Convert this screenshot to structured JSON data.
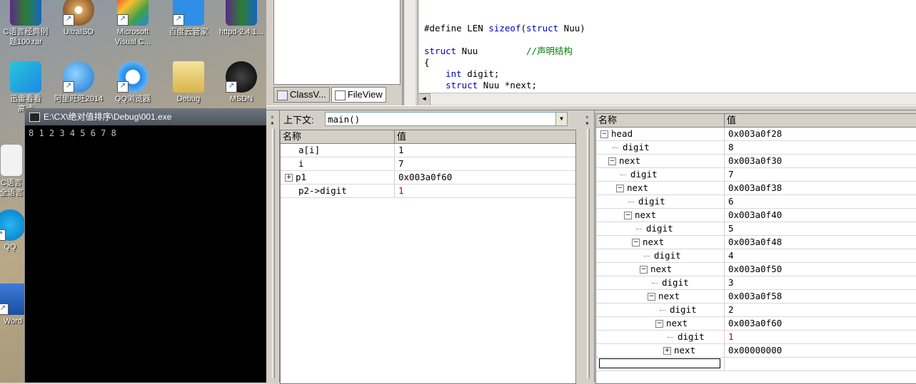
{
  "desktop": {
    "icons": [
      {
        "id": "c100",
        "label": "C语言经典例\n题100.rar"
      },
      {
        "id": "ultraiso",
        "label": "UltraISO"
      },
      {
        "id": "msvc",
        "label": "Microsoft\nVisual C..."
      },
      {
        "id": "baidu",
        "label": "百度云管家"
      },
      {
        "id": "httpd",
        "label": "httpd-2.4.1..."
      },
      {
        "id": "xunlei",
        "label": "迅雷看看\n高清"
      },
      {
        "id": "aliww",
        "label": "阿里旺旺2014"
      },
      {
        "id": "qqbrowser",
        "label": "QQ浏览器"
      },
      {
        "id": "debug",
        "label": "Debug"
      },
      {
        "id": "msdn",
        "label": "MSDN"
      },
      {
        "id": "cside",
        "label": "C语言\n全语言"
      },
      {
        "id": "qq",
        "label": "QQ"
      },
      {
        "id": "word",
        "label": "Word"
      }
    ]
  },
  "console": {
    "title": "E:\\CX\\绝对值排序\\Debug\\001.exe",
    "output": "8 1 2 3 4 5 6 7 8"
  },
  "workspace": {
    "tabs": [
      {
        "label": "ClassV..."
      },
      {
        "label": "FileView"
      }
    ]
  },
  "editor": {
    "lines": [
      {
        "pre": "#define LEN ",
        "kw": "sizeof",
        "post": "(",
        "kw2": "struct",
        "post2": " Nuu)",
        "comment": ""
      },
      {
        "pre": "",
        "kw": "",
        "post": "",
        "kw2": "",
        "post2": "",
        "comment": ""
      },
      {
        "pre": "",
        "kw": "struct",
        "post": " Nuu         ",
        "kw2": "",
        "post2": "",
        "comment": "//声明结构"
      },
      {
        "pre": "{",
        "kw": "",
        "post": "",
        "kw2": "",
        "post2": "",
        "comment": ""
      },
      {
        "pre": "    ",
        "kw": "int",
        "post": " digit;",
        "kw2": "",
        "post2": "",
        "comment": ""
      },
      {
        "pre": "    ",
        "kw": "struct",
        "post": " Nuu *next;",
        "kw2": "",
        "post2": "",
        "comment": ""
      }
    ]
  },
  "variables": {
    "context_label": "上下文:",
    "context_value": "main()",
    "col_name": "名称",
    "col_value": "值",
    "rows": [
      {
        "name": "a[i]",
        "value": "1",
        "expand": ""
      },
      {
        "name": "i",
        "value": "7",
        "expand": ""
      },
      {
        "name": "p1",
        "value": "0x003a0f60",
        "expand": "+"
      },
      {
        "name": "p2->digit",
        "value": "1",
        "expand": ""
      }
    ]
  },
  "watch": {
    "col_name": "名称",
    "col_value": "值",
    "rows": [
      {
        "name": "head",
        "value": "0x003a0f28",
        "expand": "−"
      },
      {
        "name": "digit",
        "value": "8",
        "expand": ""
      },
      {
        "name": "next",
        "value": "0x003a0f30",
        "expand": "−"
      },
      {
        "name": "digit",
        "value": "7",
        "expand": ""
      },
      {
        "name": "next",
        "value": "0x003a0f38",
        "expand": "−"
      },
      {
        "name": "digit",
        "value": "6",
        "expand": ""
      },
      {
        "name": "next",
        "value": "0x003a0f40",
        "expand": "−"
      },
      {
        "name": "digit",
        "value": "5",
        "expand": ""
      },
      {
        "name": "next",
        "value": "0x003a0f48",
        "expand": "−"
      },
      {
        "name": "digit",
        "value": "4",
        "expand": ""
      },
      {
        "name": "next",
        "value": "0x003a0f50",
        "expand": "−"
      },
      {
        "name": "digit",
        "value": "3",
        "expand": ""
      },
      {
        "name": "next",
        "value": "0x003a0f58",
        "expand": "−"
      },
      {
        "name": "digit",
        "value": "2",
        "expand": ""
      },
      {
        "name": "next",
        "value": "0x003a0f60",
        "expand": "−"
      },
      {
        "name": "digit",
        "value": "1",
        "expand": ""
      },
      {
        "name": "next",
        "value": "0x00000000",
        "expand": "+"
      }
    ]
  }
}
